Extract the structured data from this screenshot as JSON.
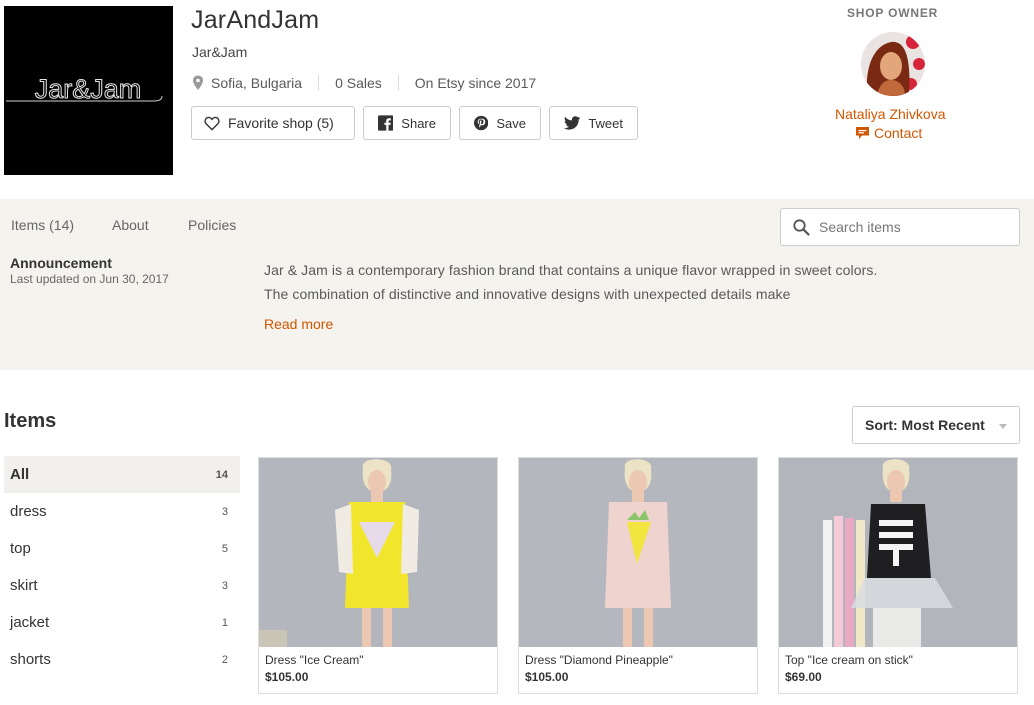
{
  "shop": {
    "name": "JarAndJam",
    "subtitle": "Jar&Jam",
    "logo_text": "Jar&Jam",
    "location": "Sofia, Bulgaria",
    "sales": "0 Sales",
    "since": "On Etsy since 2017"
  },
  "actions": {
    "favorite": "Favorite shop (5)",
    "share": "Share",
    "save": "Save",
    "tweet": "Tweet"
  },
  "owner": {
    "heading": "SHOP OWNER",
    "name": "Nataliya Zhivkova",
    "contact": "Contact"
  },
  "tabs": [
    "Items (14)",
    "About",
    "Policies"
  ],
  "search": {
    "placeholder": "Search items"
  },
  "announcement": {
    "title": "Announcement",
    "updated": "Last updated on Jun 30, 2017",
    "text": "Jar & Jam is a contemporary fashion brand that contains a unique flavor wrapped in sweet colors. The combination of distinctive and innovative designs with unexpected details make",
    "read_more": "Read more"
  },
  "items": {
    "heading": "Items",
    "sort": "Sort: Most Recent",
    "categories": [
      {
        "label": "All",
        "count": "14"
      },
      {
        "label": "dress",
        "count": "3"
      },
      {
        "label": "top",
        "count": "5"
      },
      {
        "label": "skirt",
        "count": "3"
      },
      {
        "label": "jacket",
        "count": "1"
      },
      {
        "label": "shorts",
        "count": "2"
      }
    ],
    "listings": [
      {
        "title": "Dress \"Ice Cream\"",
        "price": "$105.00"
      },
      {
        "title": "Dress \"Diamond Pineapple\"",
        "price": "$105.00"
      },
      {
        "title": "Top \"Ice cream on stick\"",
        "price": "$69.00"
      }
    ]
  },
  "colors": {
    "accent": "#d15600",
    "band": "#f5f3ee",
    "active_category": "#f1f0ed"
  },
  "icons": {
    "location": "map-pin-icon",
    "favorite": "heart-icon",
    "share": "facebook-icon",
    "save": "pinterest-icon",
    "tweet": "twitter-icon",
    "contact": "message-icon",
    "search": "search-icon",
    "sort": "caret-down-icon"
  }
}
